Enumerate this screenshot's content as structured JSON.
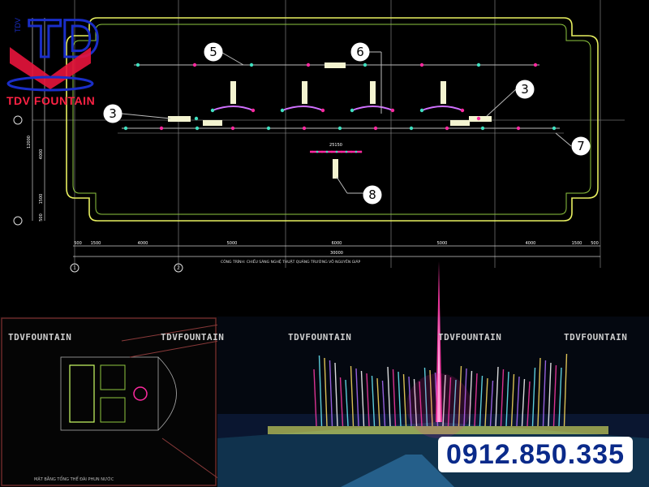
{
  "brand": {
    "logo_letters": "TD",
    "side_text": "TDV",
    "name": "TDV FOUNTAIN",
    "watermark": "TDVFOUNTAIN",
    "phone": "0912.850.335"
  },
  "drawing": {
    "callouts": [
      "5",
      "6",
      "3",
      "3",
      "7",
      "8"
    ],
    "dimension_span": "25150",
    "dims_horizontal": [
      "500",
      "1500",
      "4000",
      "5000",
      "6000",
      "5000",
      "4000",
      "1500",
      "500"
    ],
    "dim_total": "30000",
    "dims_vertical": [
      "12000",
      "4000",
      "1500",
      "500"
    ],
    "caption": "CÔNG TRÌNH: CHIẾU SÁNG NGHỆ THUẬT QUẢNG TRƯỜNG VÕ NGUYÊN GIÁP",
    "axis_markers": [
      "1",
      "2"
    ]
  },
  "site_plan": {
    "caption": "MẶT BẰNG TỔNG THỂ ĐÀI PHUN NƯỚC"
  },
  "colors": {
    "frame": "#e8f060",
    "frame_inner": "#8ec63f",
    "gridline": "#9a9a9a",
    "pink": "#ff2aa0",
    "logo_blue": "#1a2ec8",
    "logo_red": "#e8143c",
    "phone_text": "#0a2a8a"
  }
}
